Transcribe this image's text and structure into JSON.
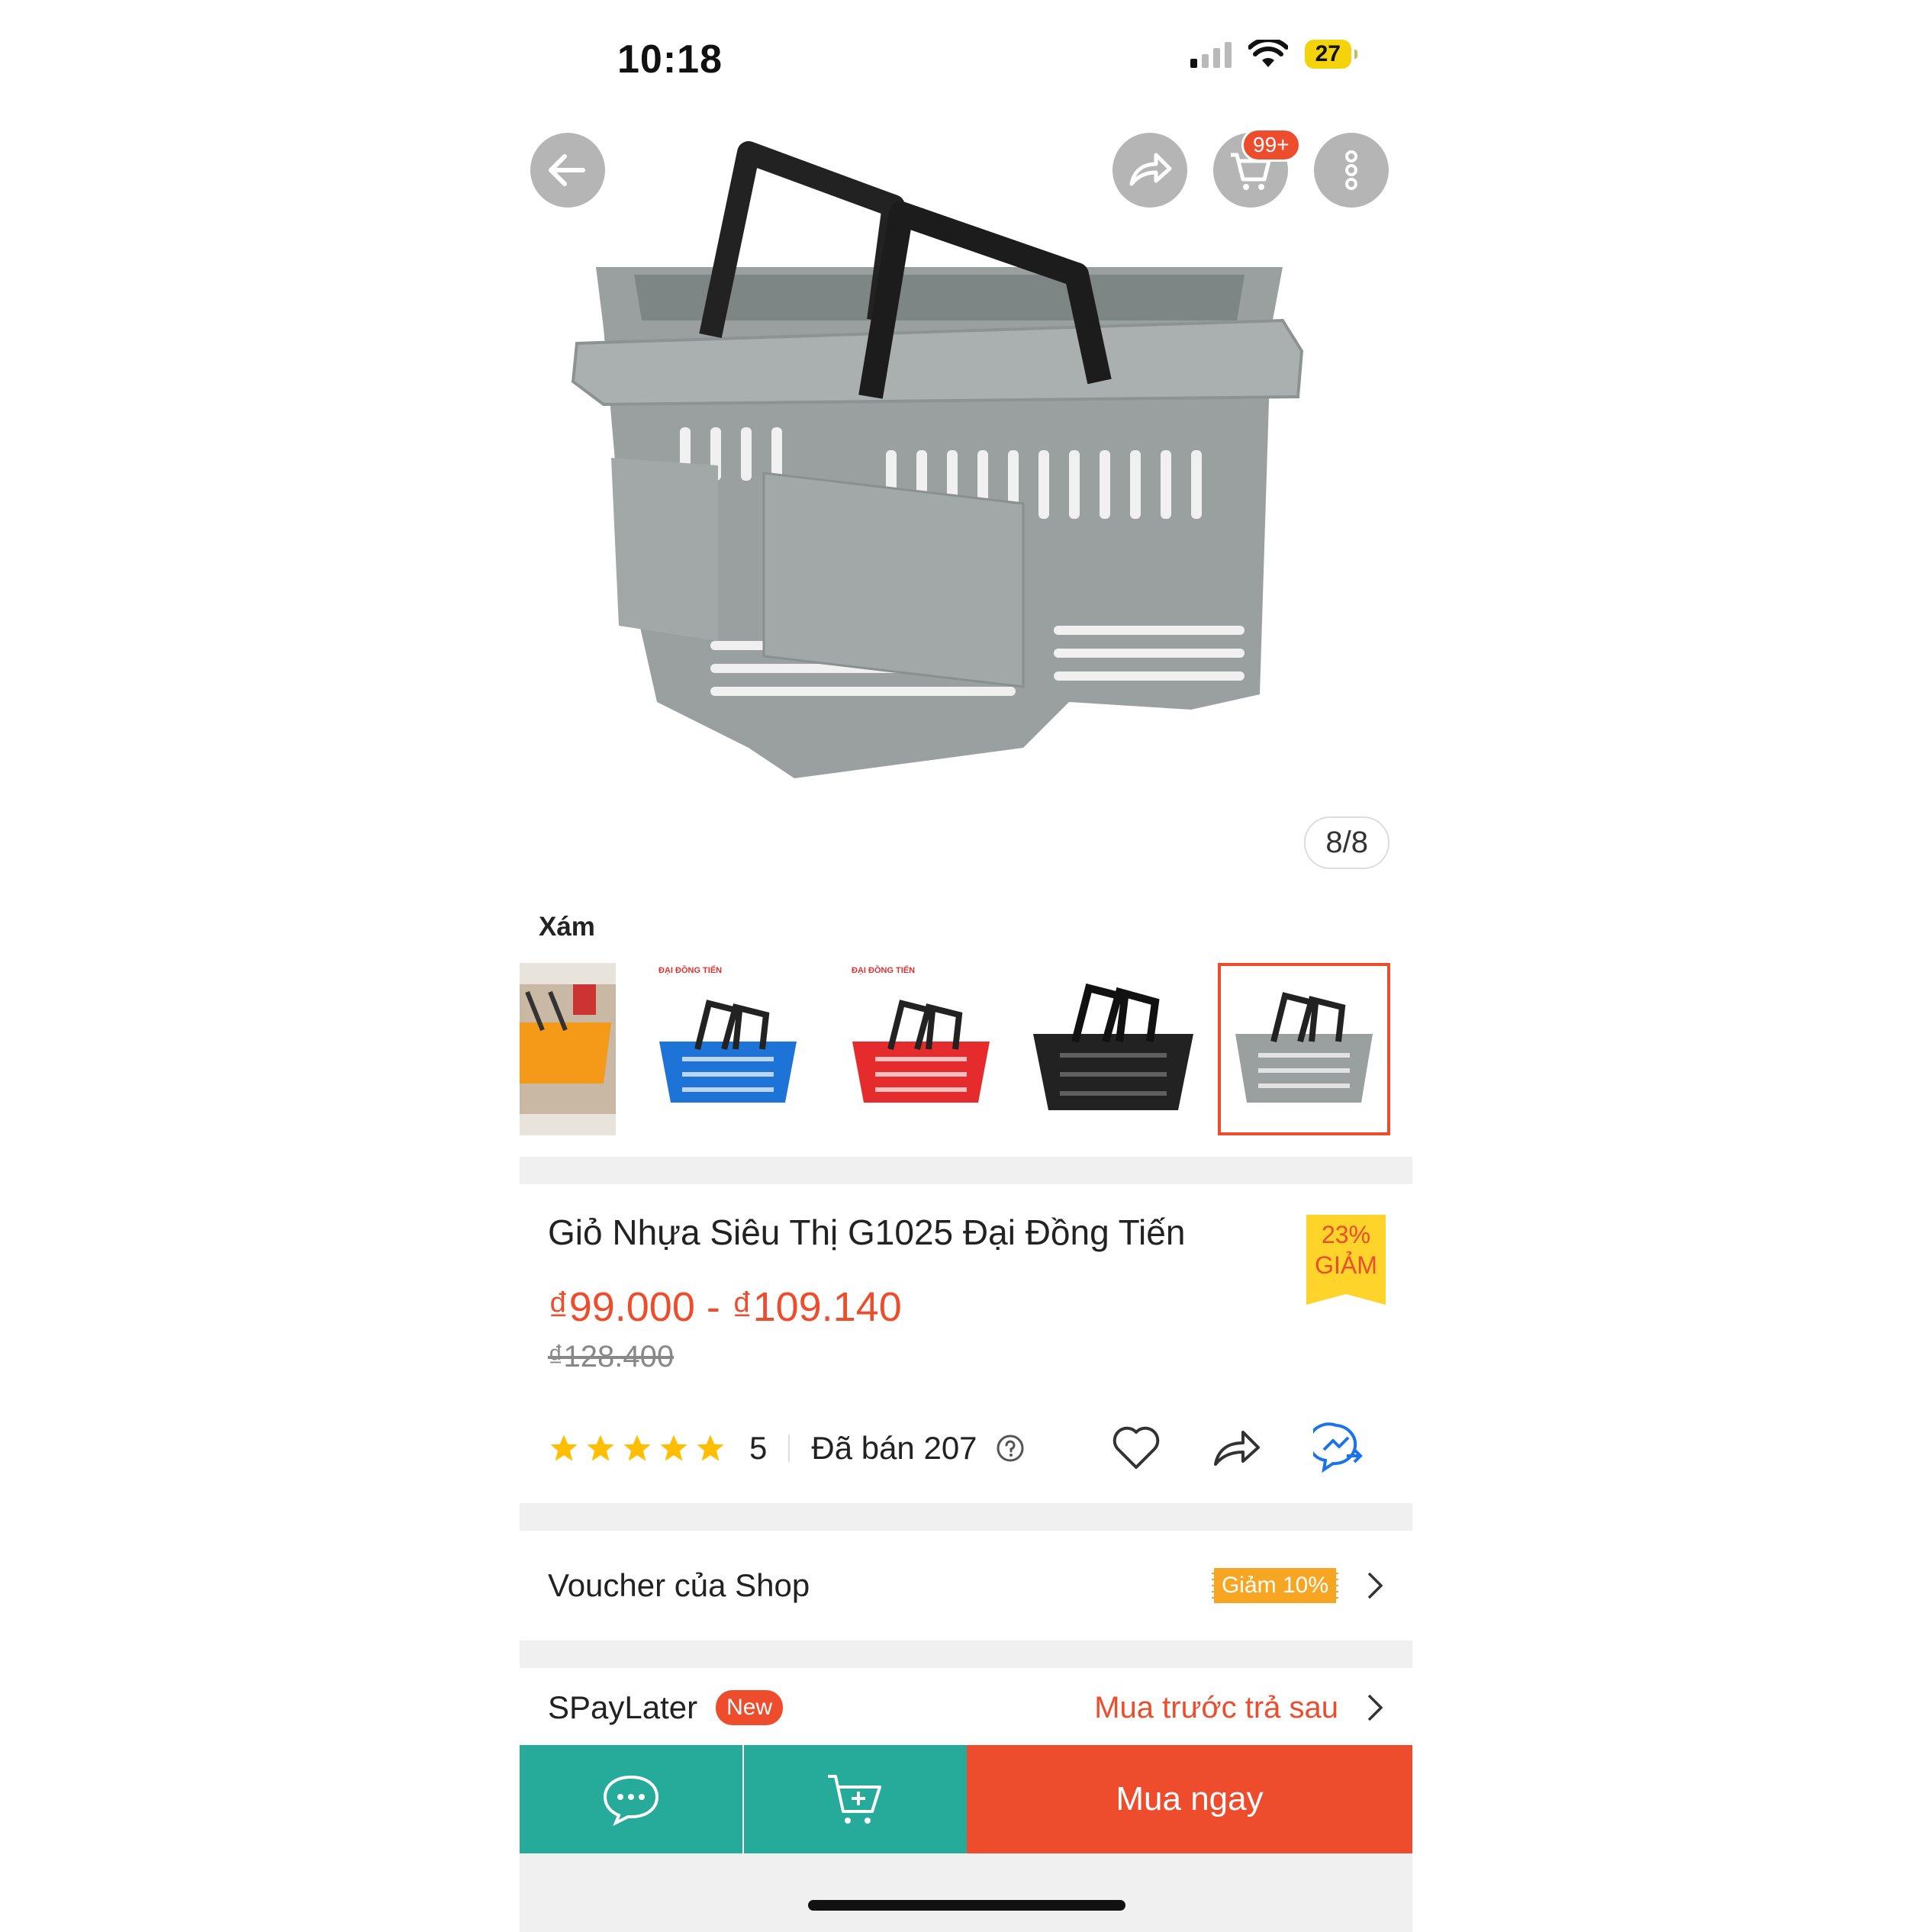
{
  "status_bar": {
    "time": "10:18",
    "battery": "27"
  },
  "hero": {
    "image_counter": "8/8",
    "cart_badge": "99+"
  },
  "variant": {
    "selected_label": "Xám"
  },
  "thumbnails": [
    {
      "color": "orange",
      "brand": ""
    },
    {
      "color": "blue",
      "brand": "ĐẠI ĐỒNG TIẾN"
    },
    {
      "color": "red",
      "brand": "ĐẠI ĐỒNG TIẾN"
    },
    {
      "color": "black",
      "brand": ""
    },
    {
      "color": "gray",
      "brand": ""
    }
  ],
  "product": {
    "title": "Giỏ Nhựa Siêu Thị G1025 Đại Đồng Tiến",
    "discount_percent": "23%",
    "discount_word": "GIẢM",
    "price_range": "₫99.000 - ₫109.140",
    "original_price": "₫128.400",
    "rating": "5",
    "sold": "Đã bán 207"
  },
  "voucher": {
    "label": "Voucher của Shop",
    "tag": "Giảm 10%"
  },
  "spaylater": {
    "label": "SPayLater",
    "badge": "New",
    "link": "Mua trước trả sau"
  },
  "bottom_bar": {
    "buy_label": "Mua ngay"
  },
  "colors": {
    "accent": "#ee4d2d",
    "teal": "#26aa99",
    "star": "#ffbf00",
    "badge_yellow": "#ffd42a",
    "voucher_orange": "#f6a623"
  },
  "icons": [
    "back-arrow-icon",
    "share-icon",
    "cart-icon",
    "more-icon",
    "star-icon",
    "help-icon",
    "heart-icon",
    "messenger-icon",
    "chevron-right-icon",
    "chat-icon",
    "add-to-cart-icon"
  ]
}
